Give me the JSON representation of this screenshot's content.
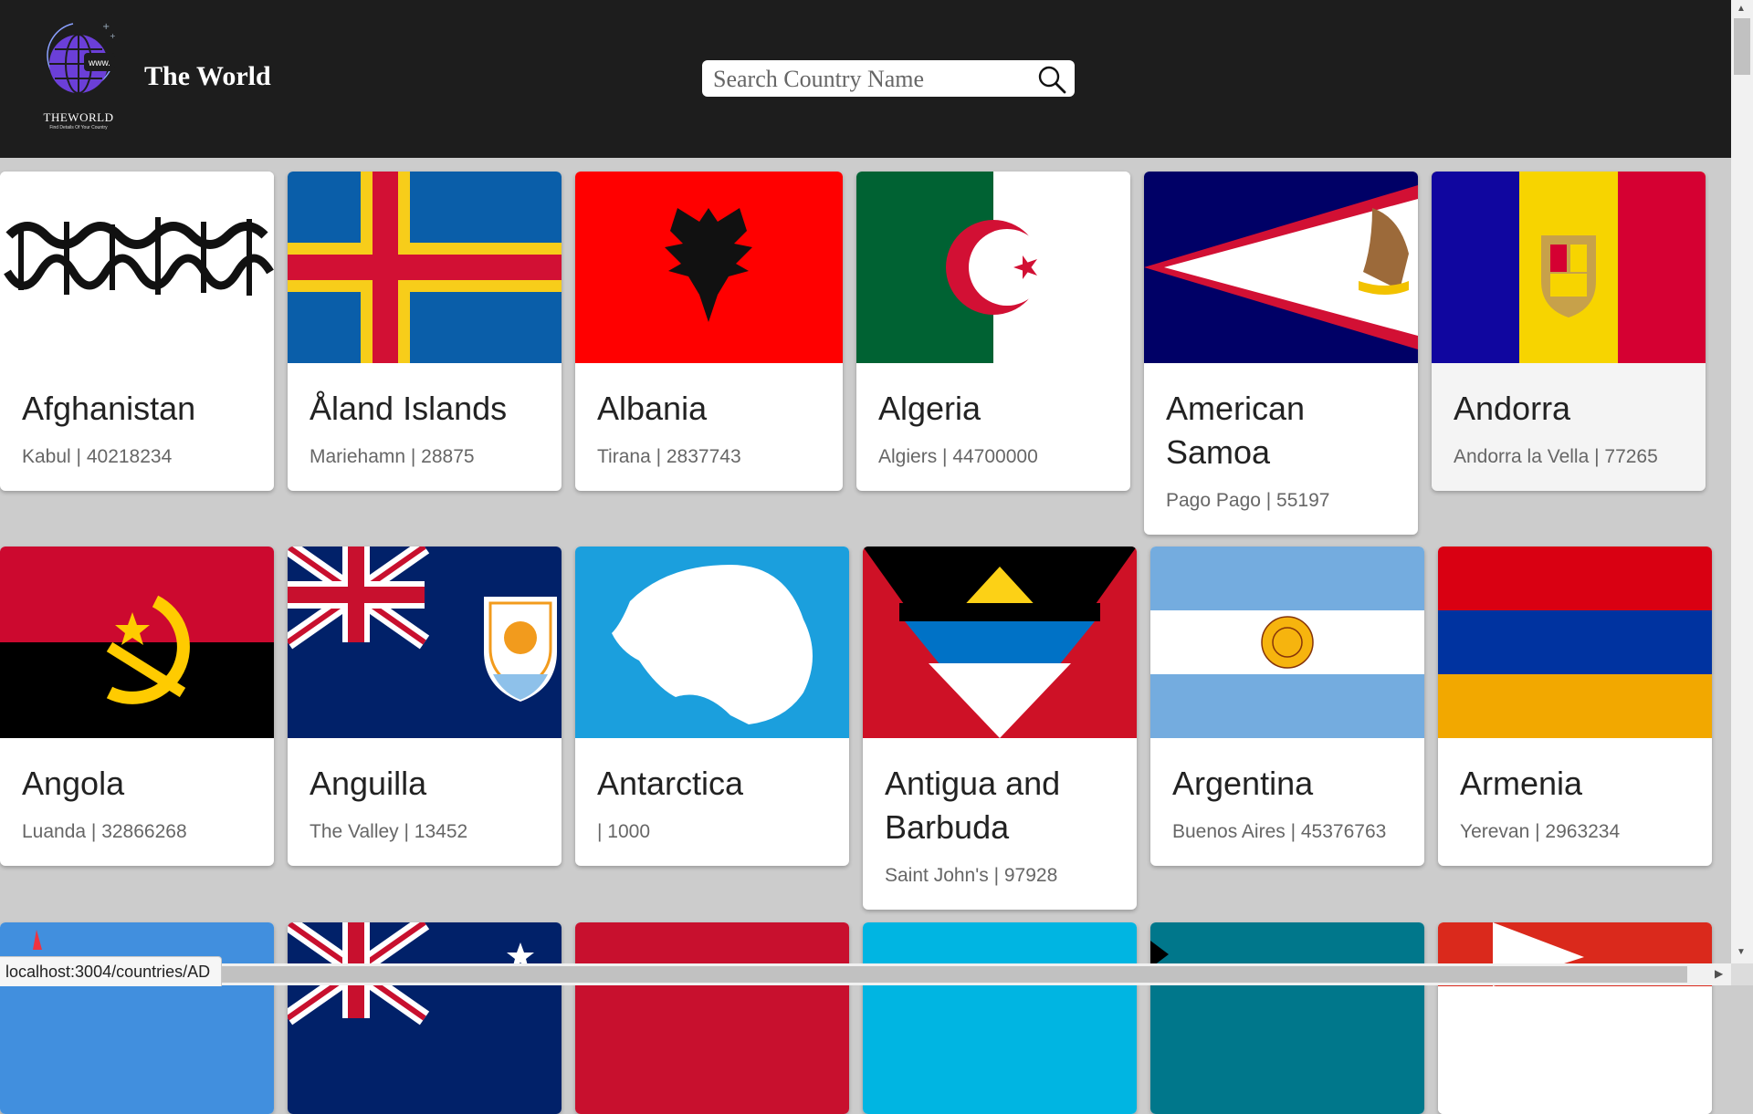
{
  "header": {
    "logo_text": "THEWORLD",
    "logo_tagline": "Find Details Of Your Country",
    "logo_www": "www.",
    "brand_name": "The World",
    "search_placeholder": "Search Country Name"
  },
  "countries": [
    {
      "name": "Afghanistan",
      "meta": "Kabul | 40218234"
    },
    {
      "name": "Åland Islands",
      "meta": "Mariehamn | 28875"
    },
    {
      "name": "Albania",
      "meta": "Tirana | 2837743"
    },
    {
      "name": "Algeria",
      "meta": "Algiers | 44700000"
    },
    {
      "name": "American Samoa",
      "meta": "Pago Pago | 55197"
    },
    {
      "name": "Andorra",
      "meta": "Andorra la Vella | 77265"
    },
    {
      "name": "Angola",
      "meta": "Luanda | 32866268"
    },
    {
      "name": "Anguilla",
      "meta": "The Valley | 13452"
    },
    {
      "name": "Antarctica",
      "meta": " | 1000"
    },
    {
      "name": "Antigua and Barbuda",
      "meta": "Saint John's | 97928"
    },
    {
      "name": "Argentina",
      "meta": "Buenos Aires | 45376763"
    },
    {
      "name": "Armenia",
      "meta": "Yerevan | 2963234"
    }
  ],
  "status_url": "localhost:3004/countries/AD",
  "colors": {
    "header_bg": "#1d1d1d",
    "page_bg": "#cccccc",
    "card_bg": "#ffffff",
    "hover_card_bg": "#f4f4f4"
  }
}
